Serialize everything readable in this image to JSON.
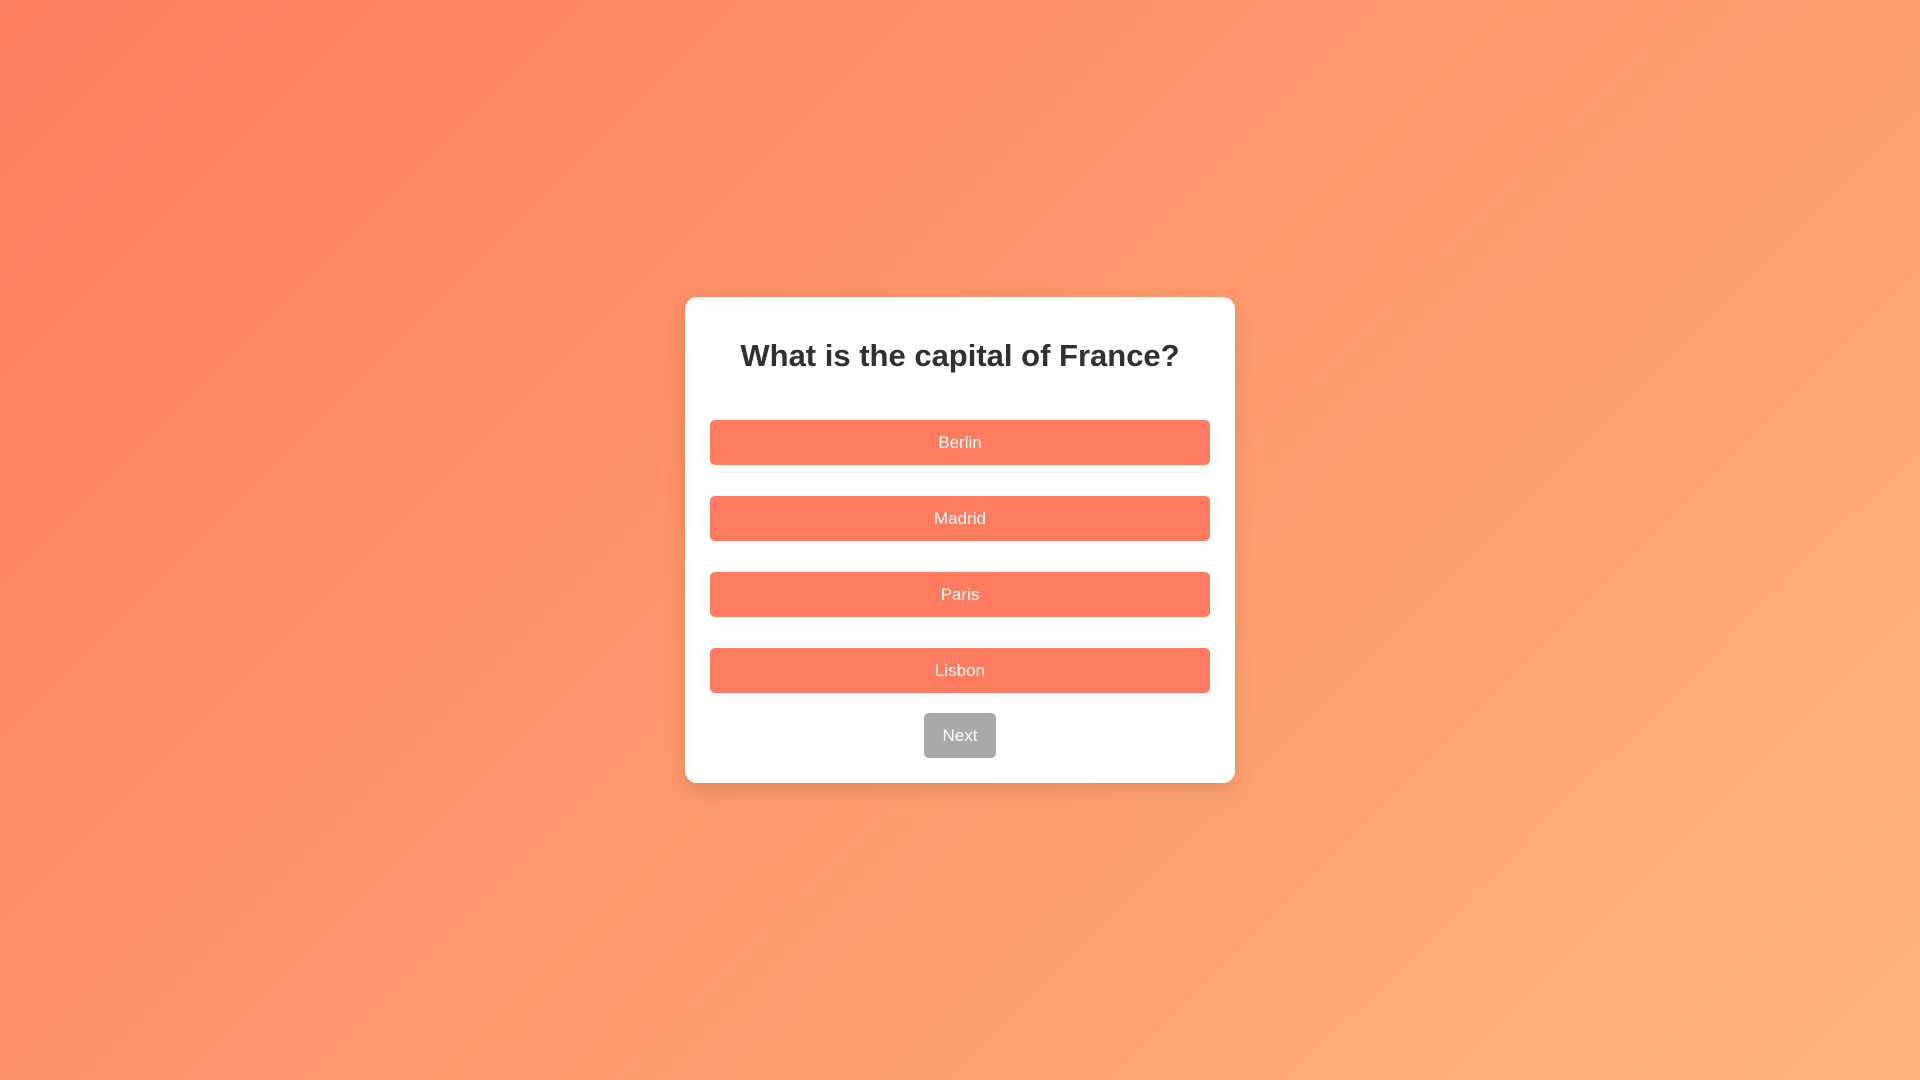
{
  "quiz": {
    "question": "What is the capital of France?",
    "options": [
      {
        "label": "Berlin"
      },
      {
        "label": "Madrid"
      },
      {
        "label": "Paris"
      },
      {
        "label": "Lisbon"
      }
    ],
    "next_label": "Next"
  },
  "colors": {
    "background_start": "#ff7e5f",
    "background_end": "#ffb47b",
    "option_button": "#ff7b5f",
    "next_button_disabled": "#a9a9a9",
    "card": "#ffffff",
    "question_text": "#2f3033"
  }
}
